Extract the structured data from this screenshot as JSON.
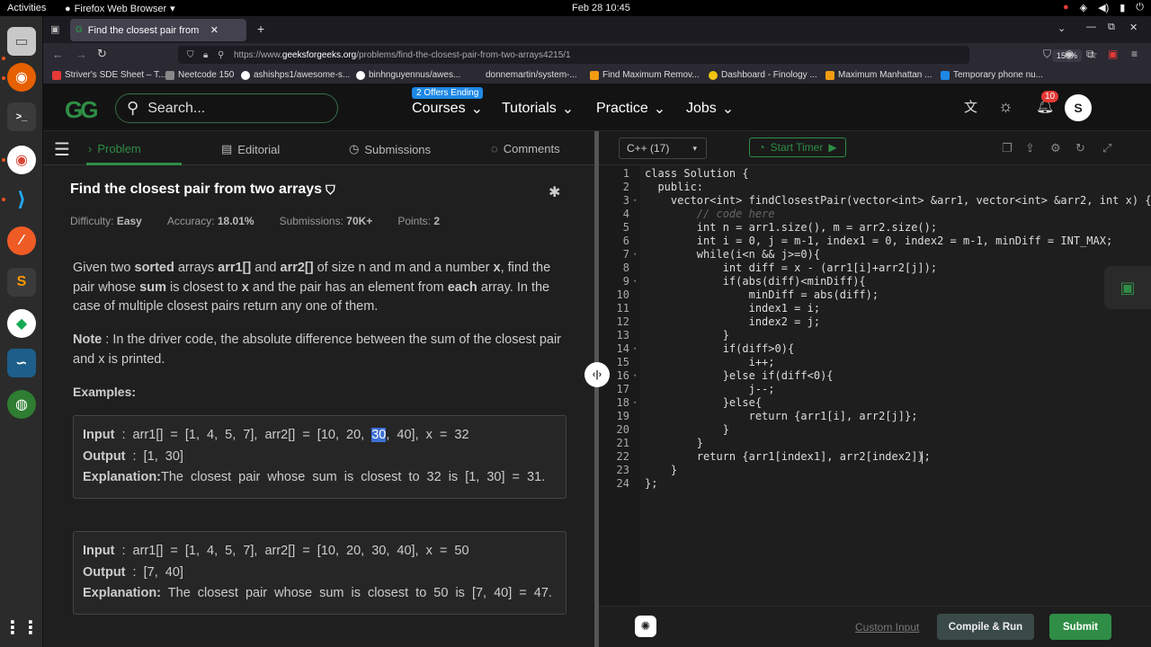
{
  "system": {
    "activities": "Activities",
    "app_name": "Firefox Web Browser",
    "clock": "Feb 28  10:45"
  },
  "browser": {
    "tab_title": "Find the closest pair from",
    "url_prefix": "https://www.",
    "url_domain": "geeksforgeeks.org",
    "url_path": "/problems/find-the-closest-pair-from-two-arrays4215/1",
    "zoom": "150%",
    "bookmarks": [
      "Striver's SDE Sheet – T...",
      "Neetcode 150",
      "ashishps1/awesome-s...",
      "binhnguyennus/awes...",
      "donnemartin/system-...",
      "Find Maximum Remov...",
      "Dashboard - Finology ...",
      "Maximum Manhattan ...",
      "Temporary phone nu..."
    ]
  },
  "site": {
    "logo": "GG",
    "search_placeholder": "Search...",
    "offer_badge": "2 Offers Ending",
    "menu": [
      "Courses",
      "Tutorials",
      "Practice",
      "Jobs"
    ],
    "notification_count": "10",
    "avatar_letter": "S"
  },
  "left_tabs": [
    "Problem",
    "Editorial",
    "Submissions",
    "Comments"
  ],
  "problem": {
    "title": "Find the closest pair from two arrays",
    "difficulty_label": "Difficulty:",
    "difficulty": "Easy",
    "accuracy_label": "Accuracy:",
    "accuracy": "18.01%",
    "submissions_label": "Submissions:",
    "submissions": "70K+",
    "points_label": "Points:",
    "points": "2",
    "statement": "Given two <b>sorted</b> arrays <b>arr1[]</b> and <b>arr2[]</b> of size n and m and a number <b>x</b>, find the pair whose <b>sum</b> is closest to <b>x</b> and the pair has an element from <b>each</b> array. In the case of multiple closest pairs return any one of them.",
    "note": "<b>Note</b> : In the driver code, the absolute difference between the sum of the closest pair and x is printed.",
    "examples_heading": "Examples:",
    "examples": [
      {
        "input": "arr1[] = [1, 4, 5, 7], arr2[] = [10, 20, <span class=\"hl\">30</span>, 40], x = 32",
        "output": "[1, 30]",
        "explanation": "The closest pair whose sum is closest to 32 is [1, 30] = 31."
      },
      {
        "input": "arr1[] = [1, 4, 5, 7], arr2[] = [10, 20, 30, 40], x = 50",
        "output": "[7, 40]",
        "explanation": " The closest pair whose sum is closest to 50 is [7, 40] = 47."
      }
    ],
    "input_label": "Input",
    "output_label": "Output",
    "explanation_label": "Explanation:"
  },
  "editor": {
    "language": "C++ (17)",
    "timer_label": "Start Timer",
    "lines": [
      "class Solution {",
      "  public:",
      "    vector<int> findClosestPair(vector<int> &arr1, vector<int> &arr2, int x) {",
      "        // code here",
      "        int n = arr1.size(), m = arr2.size();",
      "        int i = 0, j = m-1, index1 = 0, index2 = m-1, minDiff = INT_MAX;",
      "        while(i<n && j>=0){",
      "            int diff = x - (arr1[i]+arr2[j]);",
      "            if(abs(diff)<minDiff){",
      "                minDiff = abs(diff);",
      "                index1 = i;",
      "                index2 = j;",
      "            }",
      "            if(diff>0){",
      "                i++;",
      "            }else if(diff<0){",
      "                j--;",
      "            }else{",
      "                return {arr1[i], arr2[j]};",
      "            }",
      "        }",
      "        return {arr1[index1], arr2[index2]};",
      "    }",
      "};"
    ],
    "fold_lines": [
      3,
      7,
      9,
      14,
      16,
      18
    ],
    "custom_input": "Custom Input",
    "compile_label": "Compile & Run",
    "submit_label": "Submit"
  }
}
